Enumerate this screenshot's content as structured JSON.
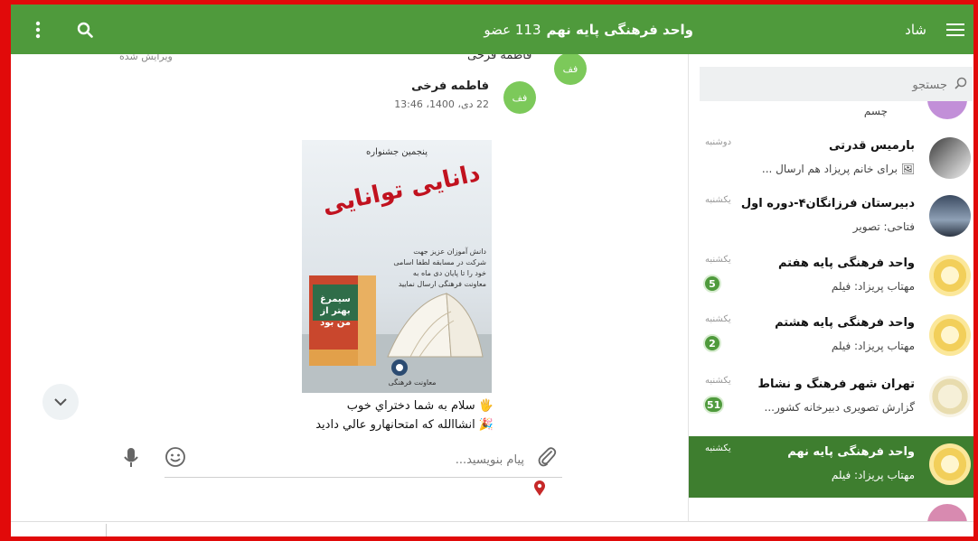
{
  "header": {
    "menu_icon": "kebab-menu-icon",
    "search_icon": "search-icon",
    "group_name": "واحد فرهنگی پایه نهم",
    "member_count": "113 عضو",
    "app_name": "شاد",
    "hamburger_icon": "hamburger-menu-icon"
  },
  "previous_message": {
    "sender": "فاطمه فرخی",
    "edited": "ویرایش شده"
  },
  "message": {
    "avatar_initials": "فف",
    "sender": "فاطمه فرخی",
    "timestamp": "22 دی، 1400، 13:46",
    "caption_line1": "🖐 سلام به شما دختراي خوب",
    "caption_line2": "🎉 انشاالله که امتحانهارو عالي داديد",
    "poster": {
      "heading": "پنجمین جشنواره",
      "title": "دانایی توانایی",
      "body": "دانش آموزان عزیز جهت شرکت در مسابقه لطفا اسامی خود را تا پایان دی ماه به معاونت فرهنگی ارسال نمایید",
      "book": "سیمرغ بهتر از من بود",
      "footer": "معاونت فرهنگی"
    }
  },
  "composer": {
    "placeholder": "پیام بنویسید...",
    "emoji_icon": "smiley-icon",
    "attach_icon": "paperclip-icon",
    "mic_icon": "microphone-icon",
    "location_icon": "location-pin-icon"
  },
  "sidebar": {
    "search_placeholder": "جستجو",
    "peek_top_label": "چسم",
    "chats": [
      {
        "title": "بارمیس قدرتی",
        "subtitle": "🖼 برای خانم پریزاد هم ارسال ...",
        "day": "دوشنبه",
        "badge": ""
      },
      {
        "title": "دبیرستان فرزانگان۴-دوره اول",
        "subtitle": "فتاحی: تصویر",
        "day": "یکشنبه",
        "badge": ""
      },
      {
        "title": "واحد فرهنگی پایه هفتم",
        "subtitle": "مهتاب پریزاد: فیلم",
        "day": "یکشنبه",
        "badge": "5"
      },
      {
        "title": "واحد فرهنگی پایه هشتم",
        "subtitle": "مهتاب پریزاد: فیلم",
        "day": "یکشنبه",
        "badge": "2"
      },
      {
        "title": "تهران شهر فرهنگ و نشاط",
        "subtitle": "گزارش تصویری دبیرخانه کشور...",
        "day": "یکشنبه",
        "badge": "51"
      },
      {
        "title": "واحد فرهنگی پایه نهم",
        "subtitle": "مهتاب پریزاد: فیلم",
        "day": "یکشنبه",
        "badge": ""
      }
    ]
  },
  "colors": {
    "brand_green": "#4f9a3c",
    "active_green": "#3e7e2f",
    "avatar_green": "#7cc95a",
    "location_red": "#c62828",
    "frame_red": "#e10a0a"
  }
}
